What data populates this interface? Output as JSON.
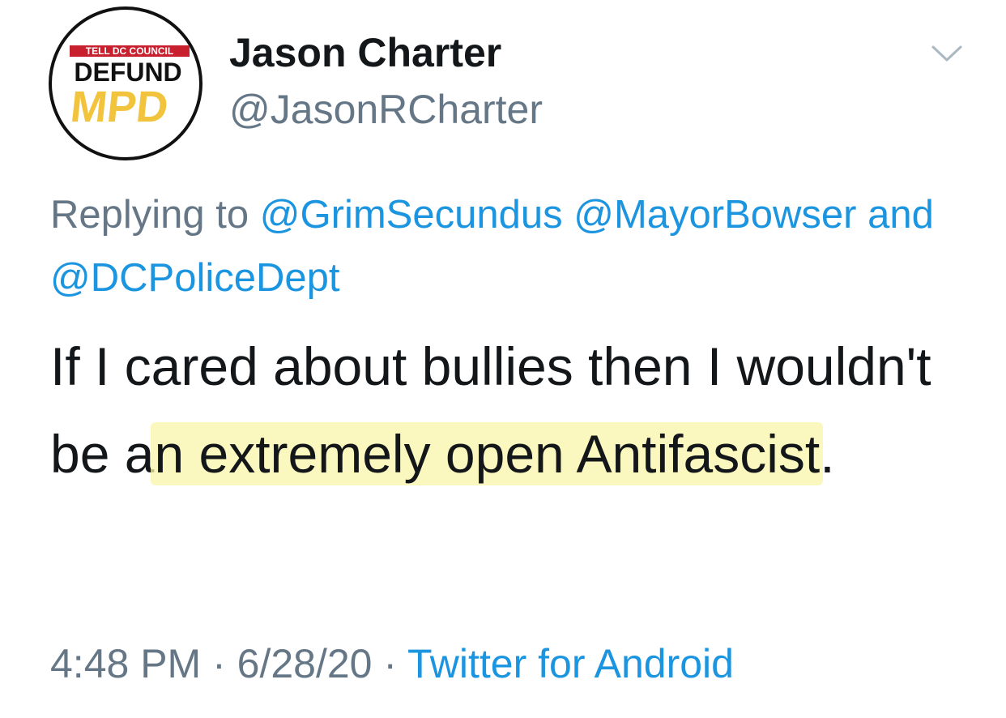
{
  "tweet": {
    "avatar": {
      "banner_text": "TELL DC COUNCIL",
      "line1": "DEFUND",
      "line2": "MPD",
      "colors": {
        "banner": "#c8202f",
        "accent": "#f2c43d",
        "ink": "#111111"
      }
    },
    "display_name": "Jason Charter",
    "handle": "@JasonRCharter",
    "menu_icon": "chevron-down-icon",
    "reply": {
      "prefix": "Replying to ",
      "mention_1": "@GrimSecundus",
      "mention_2": "@MayorBowser",
      "connector": " and ",
      "mention_3": "@DCPoliceDept"
    },
    "text": {
      "part_1": "If I cared about bullies then I wouldn't be a",
      "highlighted": "n extremely open Antifascist",
      "part_2": "."
    },
    "meta": {
      "time": "4:48 PM",
      "separator": " · ",
      "date": "6/28/20",
      "source": "Twitter for Android"
    },
    "colors": {
      "link": "#1b95e0",
      "muted": "#657786",
      "text": "#14171a",
      "highlight": "#faf6aa"
    }
  }
}
